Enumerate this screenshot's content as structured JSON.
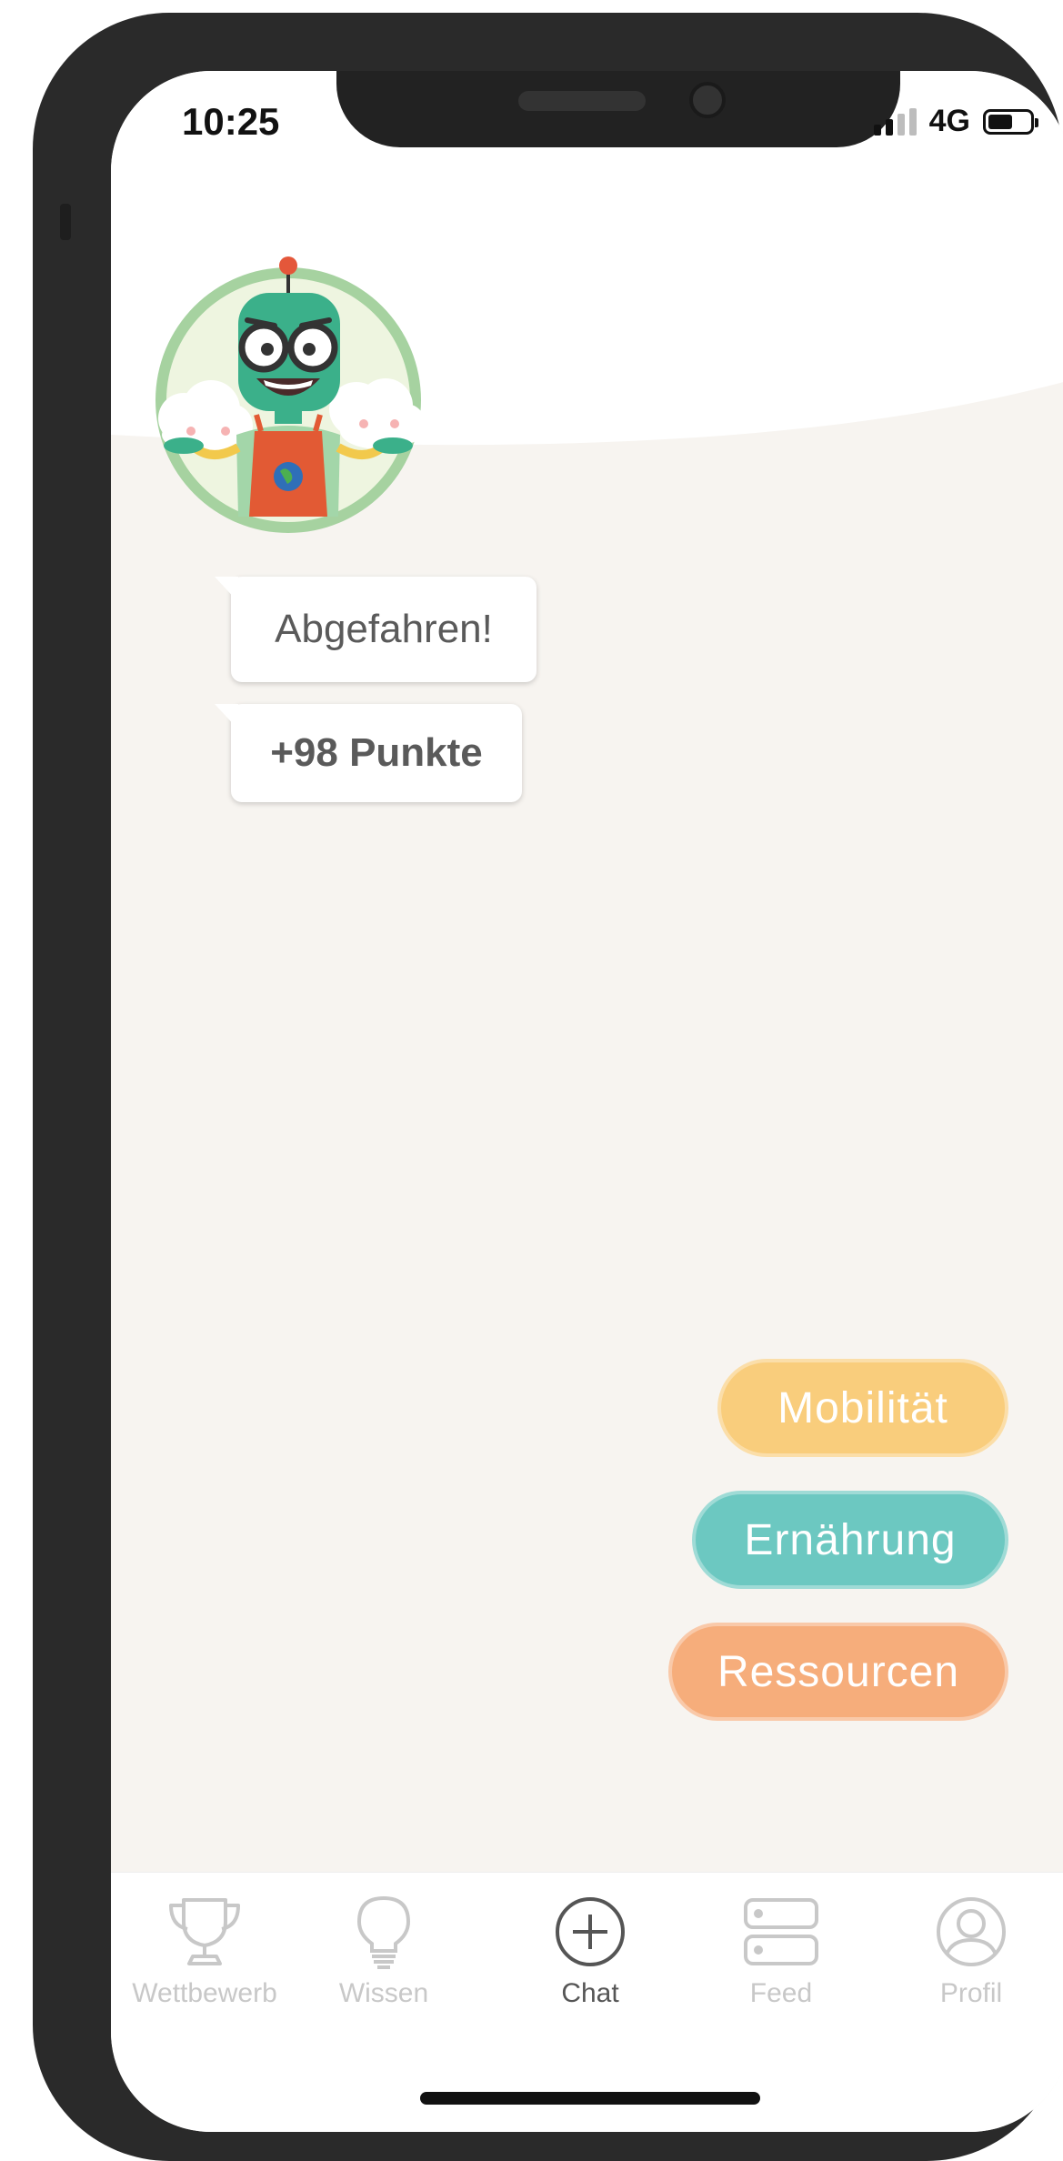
{
  "status_bar": {
    "time": "10:25",
    "network": "4G",
    "signal_bars_active": 2,
    "signal_bars_total": 4,
    "battery_level": 0.6
  },
  "mascot": {
    "icon": "robot-mascot-icon"
  },
  "chat": {
    "messages": [
      {
        "text": "Abgefahren!"
      },
      {
        "text": "+98 Punkte"
      }
    ]
  },
  "categories": [
    {
      "label": "Mobilität",
      "color": "#f9cd7c"
    },
    {
      "label": "Ernährung",
      "color": "#6cc8c1"
    },
    {
      "label": "Ressourcen",
      "color": "#f6ad7b"
    }
  ],
  "tabbar": {
    "tabs": [
      {
        "label": "Wettbewerb",
        "icon": "trophy-icon",
        "active": false
      },
      {
        "label": "Wissen",
        "icon": "lightbulb-icon",
        "active": false
      },
      {
        "label": "Chat",
        "icon": "plus-circle-icon",
        "active": true
      },
      {
        "label": "Feed",
        "icon": "feed-icon",
        "active": false
      },
      {
        "label": "Profil",
        "icon": "profile-icon",
        "active": false
      }
    ]
  },
  "colors": {
    "background": "#f7f4f0",
    "inactive_tab": "#c8c8c8",
    "active_tab": "#555555"
  }
}
